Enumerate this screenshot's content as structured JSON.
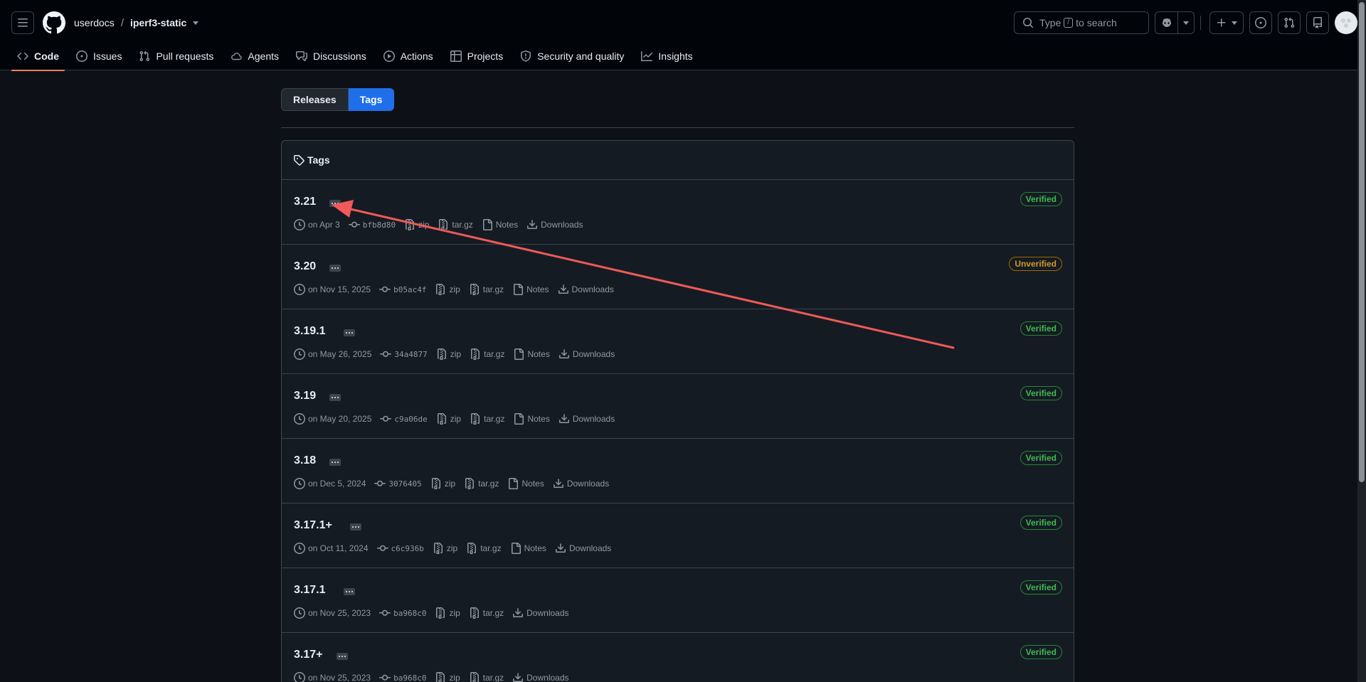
{
  "header": {
    "owner": "userdocs",
    "separator": "/",
    "repo": "iperf3-static",
    "search_before": "Type",
    "search_key": "/",
    "search_after": "to search"
  },
  "nav_tabs": [
    {
      "label": "Code",
      "icon": "code-icon",
      "active": true
    },
    {
      "label": "Issues",
      "icon": "issue-opened-icon"
    },
    {
      "label": "Pull requests",
      "icon": "git-pull-request-icon"
    },
    {
      "label": "Agents",
      "icon": "agent-icon"
    },
    {
      "label": "Discussions",
      "icon": "comment-discussion-icon"
    },
    {
      "label": "Actions",
      "icon": "play-icon"
    },
    {
      "label": "Projects",
      "icon": "table-icon"
    },
    {
      "label": "Security and quality",
      "icon": "shield-icon"
    },
    {
      "label": "Insights",
      "icon": "graph-icon"
    }
  ],
  "subnav": {
    "releases": "Releases",
    "tags": "Tags"
  },
  "box": {
    "title": "Tags"
  },
  "meta_labels": {
    "zip": "zip",
    "targz": "tar.gz",
    "notes": "Notes",
    "downloads": "Downloads"
  },
  "tags": [
    {
      "name": "3.21",
      "status": "Verified",
      "date": "on Apr 3",
      "sha": "bfb8d80",
      "notes": true
    },
    {
      "name": "3.20",
      "status": "Unverified",
      "date": "on Nov 15, 2025",
      "sha": "b05ac4f",
      "notes": true
    },
    {
      "name": "3.19.1",
      "status": "Verified",
      "date": "on May 26, 2025",
      "sha": "34a4877",
      "notes": true
    },
    {
      "name": "3.19",
      "status": "Verified",
      "date": "on May 20, 2025",
      "sha": "c9a06de",
      "notes": true
    },
    {
      "name": "3.18",
      "status": "Verified",
      "date": "on Dec 5, 2024",
      "sha": "3076405",
      "notes": true
    },
    {
      "name": "3.17.1+",
      "status": "Verified",
      "date": "on Oct 11, 2024",
      "sha": "c6c936b",
      "notes": true
    },
    {
      "name": "3.17.1",
      "status": "Verified",
      "date": "on Nov 25, 2023",
      "sha": "ba968c0",
      "notes": false
    },
    {
      "name": "3.17+",
      "status": "Verified",
      "date": "on Nov 25, 2023",
      "sha": "ba968c0",
      "notes": false
    }
  ],
  "colors": {
    "background": "#0d1117",
    "accent": "#1f6feb",
    "verified": "#3fb950",
    "unverified": "#d29922",
    "annotation_arrow": "#f05a5a"
  }
}
